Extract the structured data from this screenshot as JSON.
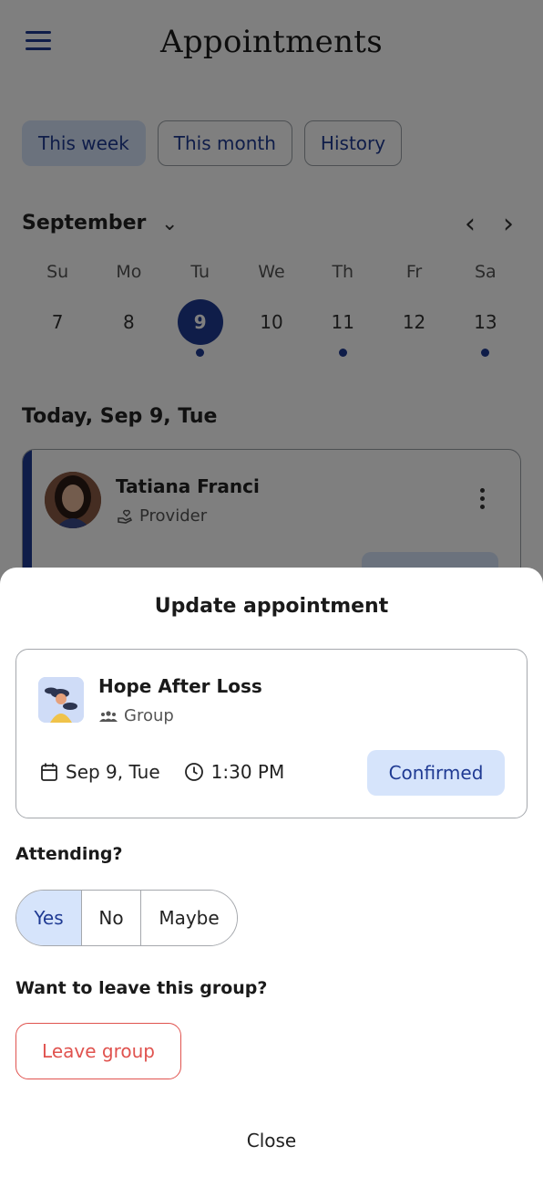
{
  "header": {
    "title": "Appointments"
  },
  "filters": [
    {
      "label": "This week",
      "active": true
    },
    {
      "label": "This month",
      "active": false
    },
    {
      "label": "History",
      "active": false
    }
  ],
  "calendar": {
    "month": "September",
    "weekdays": [
      "Su",
      "Mo",
      "Tu",
      "We",
      "Th",
      "Fr",
      "Sa"
    ],
    "dates": [
      "7",
      "8",
      "9",
      "10",
      "11",
      "12",
      "13"
    ],
    "selected": "9",
    "dots_on": [
      "9",
      "11",
      "13"
    ]
  },
  "day_heading": "Today, Sep 9, Tue",
  "background_card": {
    "name": "Tatiana Franci",
    "role": "Provider"
  },
  "sheet": {
    "title": "Update appointment",
    "appointment": {
      "name": "Hope After Loss",
      "type": "Group",
      "date": "Sep 9, Tue",
      "time": "1:30 PM",
      "status": "Confirmed"
    },
    "attending_question": "Attending?",
    "attending_options": [
      "Yes",
      "No",
      "Maybe"
    ],
    "attending_selected": "Yes",
    "leave_question": "Want to leave this group?",
    "leave_button": "Leave group",
    "close_button": "Close"
  },
  "colors": {
    "accent": "#1f3a93",
    "accent_light": "#d6e4fb",
    "danger": "#e0534f"
  }
}
